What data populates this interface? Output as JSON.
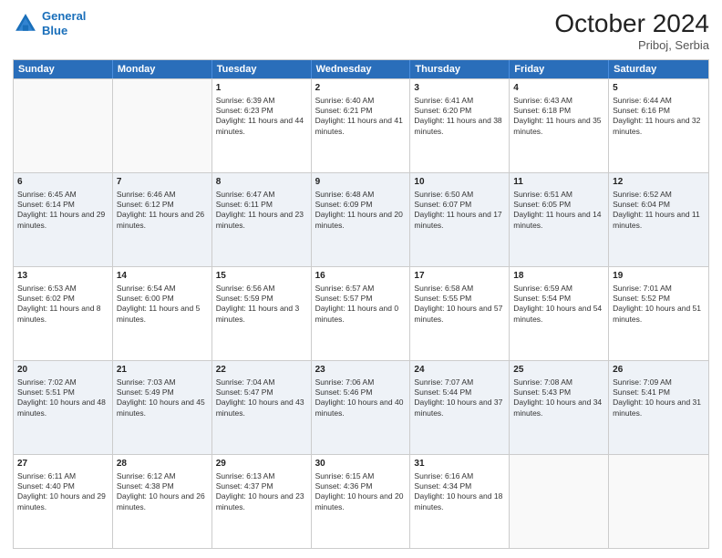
{
  "header": {
    "logo_line1": "General",
    "logo_line2": "Blue",
    "month": "October 2024",
    "location": "Priboj, Serbia"
  },
  "weekdays": [
    "Sunday",
    "Monday",
    "Tuesday",
    "Wednesday",
    "Thursday",
    "Friday",
    "Saturday"
  ],
  "rows": [
    [
      {
        "day": "",
        "sunrise": "",
        "sunset": "",
        "daylight": "",
        "empty": true
      },
      {
        "day": "",
        "sunrise": "",
        "sunset": "",
        "daylight": "",
        "empty": true
      },
      {
        "day": "1",
        "sunrise": "Sunrise: 6:39 AM",
        "sunset": "Sunset: 6:23 PM",
        "daylight": "Daylight: 11 hours and 44 minutes.",
        "empty": false
      },
      {
        "day": "2",
        "sunrise": "Sunrise: 6:40 AM",
        "sunset": "Sunset: 6:21 PM",
        "daylight": "Daylight: 11 hours and 41 minutes.",
        "empty": false
      },
      {
        "day": "3",
        "sunrise": "Sunrise: 6:41 AM",
        "sunset": "Sunset: 6:20 PM",
        "daylight": "Daylight: 11 hours and 38 minutes.",
        "empty": false
      },
      {
        "day": "4",
        "sunrise": "Sunrise: 6:43 AM",
        "sunset": "Sunset: 6:18 PM",
        "daylight": "Daylight: 11 hours and 35 minutes.",
        "empty": false
      },
      {
        "day": "5",
        "sunrise": "Sunrise: 6:44 AM",
        "sunset": "Sunset: 6:16 PM",
        "daylight": "Daylight: 11 hours and 32 minutes.",
        "empty": false
      }
    ],
    [
      {
        "day": "6",
        "sunrise": "Sunrise: 6:45 AM",
        "sunset": "Sunset: 6:14 PM",
        "daylight": "Daylight: 11 hours and 29 minutes.",
        "empty": false
      },
      {
        "day": "7",
        "sunrise": "Sunrise: 6:46 AM",
        "sunset": "Sunset: 6:12 PM",
        "daylight": "Daylight: 11 hours and 26 minutes.",
        "empty": false
      },
      {
        "day": "8",
        "sunrise": "Sunrise: 6:47 AM",
        "sunset": "Sunset: 6:11 PM",
        "daylight": "Daylight: 11 hours and 23 minutes.",
        "empty": false
      },
      {
        "day": "9",
        "sunrise": "Sunrise: 6:48 AM",
        "sunset": "Sunset: 6:09 PM",
        "daylight": "Daylight: 11 hours and 20 minutes.",
        "empty": false
      },
      {
        "day": "10",
        "sunrise": "Sunrise: 6:50 AM",
        "sunset": "Sunset: 6:07 PM",
        "daylight": "Daylight: 11 hours and 17 minutes.",
        "empty": false
      },
      {
        "day": "11",
        "sunrise": "Sunrise: 6:51 AM",
        "sunset": "Sunset: 6:05 PM",
        "daylight": "Daylight: 11 hours and 14 minutes.",
        "empty": false
      },
      {
        "day": "12",
        "sunrise": "Sunrise: 6:52 AM",
        "sunset": "Sunset: 6:04 PM",
        "daylight": "Daylight: 11 hours and 11 minutes.",
        "empty": false
      }
    ],
    [
      {
        "day": "13",
        "sunrise": "Sunrise: 6:53 AM",
        "sunset": "Sunset: 6:02 PM",
        "daylight": "Daylight: 11 hours and 8 minutes.",
        "empty": false
      },
      {
        "day": "14",
        "sunrise": "Sunrise: 6:54 AM",
        "sunset": "Sunset: 6:00 PM",
        "daylight": "Daylight: 11 hours and 5 minutes.",
        "empty": false
      },
      {
        "day": "15",
        "sunrise": "Sunrise: 6:56 AM",
        "sunset": "Sunset: 5:59 PM",
        "daylight": "Daylight: 11 hours and 3 minutes.",
        "empty": false
      },
      {
        "day": "16",
        "sunrise": "Sunrise: 6:57 AM",
        "sunset": "Sunset: 5:57 PM",
        "daylight": "Daylight: 11 hours and 0 minutes.",
        "empty": false
      },
      {
        "day": "17",
        "sunrise": "Sunrise: 6:58 AM",
        "sunset": "Sunset: 5:55 PM",
        "daylight": "Daylight: 10 hours and 57 minutes.",
        "empty": false
      },
      {
        "day": "18",
        "sunrise": "Sunrise: 6:59 AM",
        "sunset": "Sunset: 5:54 PM",
        "daylight": "Daylight: 10 hours and 54 minutes.",
        "empty": false
      },
      {
        "day": "19",
        "sunrise": "Sunrise: 7:01 AM",
        "sunset": "Sunset: 5:52 PM",
        "daylight": "Daylight: 10 hours and 51 minutes.",
        "empty": false
      }
    ],
    [
      {
        "day": "20",
        "sunrise": "Sunrise: 7:02 AM",
        "sunset": "Sunset: 5:51 PM",
        "daylight": "Daylight: 10 hours and 48 minutes.",
        "empty": false
      },
      {
        "day": "21",
        "sunrise": "Sunrise: 7:03 AM",
        "sunset": "Sunset: 5:49 PM",
        "daylight": "Daylight: 10 hours and 45 minutes.",
        "empty": false
      },
      {
        "day": "22",
        "sunrise": "Sunrise: 7:04 AM",
        "sunset": "Sunset: 5:47 PM",
        "daylight": "Daylight: 10 hours and 43 minutes.",
        "empty": false
      },
      {
        "day": "23",
        "sunrise": "Sunrise: 7:06 AM",
        "sunset": "Sunset: 5:46 PM",
        "daylight": "Daylight: 10 hours and 40 minutes.",
        "empty": false
      },
      {
        "day": "24",
        "sunrise": "Sunrise: 7:07 AM",
        "sunset": "Sunset: 5:44 PM",
        "daylight": "Daylight: 10 hours and 37 minutes.",
        "empty": false
      },
      {
        "day": "25",
        "sunrise": "Sunrise: 7:08 AM",
        "sunset": "Sunset: 5:43 PM",
        "daylight": "Daylight: 10 hours and 34 minutes.",
        "empty": false
      },
      {
        "day": "26",
        "sunrise": "Sunrise: 7:09 AM",
        "sunset": "Sunset: 5:41 PM",
        "daylight": "Daylight: 10 hours and 31 minutes.",
        "empty": false
      }
    ],
    [
      {
        "day": "27",
        "sunrise": "Sunrise: 6:11 AM",
        "sunset": "Sunset: 4:40 PM",
        "daylight": "Daylight: 10 hours and 29 minutes.",
        "empty": false
      },
      {
        "day": "28",
        "sunrise": "Sunrise: 6:12 AM",
        "sunset": "Sunset: 4:38 PM",
        "daylight": "Daylight: 10 hours and 26 minutes.",
        "empty": false
      },
      {
        "day": "29",
        "sunrise": "Sunrise: 6:13 AM",
        "sunset": "Sunset: 4:37 PM",
        "daylight": "Daylight: 10 hours and 23 minutes.",
        "empty": false
      },
      {
        "day": "30",
        "sunrise": "Sunrise: 6:15 AM",
        "sunset": "Sunset: 4:36 PM",
        "daylight": "Daylight: 10 hours and 20 minutes.",
        "empty": false
      },
      {
        "day": "31",
        "sunrise": "Sunrise: 6:16 AM",
        "sunset": "Sunset: 4:34 PM",
        "daylight": "Daylight: 10 hours and 18 minutes.",
        "empty": false
      },
      {
        "day": "",
        "sunrise": "",
        "sunset": "",
        "daylight": "",
        "empty": true
      },
      {
        "day": "",
        "sunrise": "",
        "sunset": "",
        "daylight": "",
        "empty": true
      }
    ]
  ]
}
